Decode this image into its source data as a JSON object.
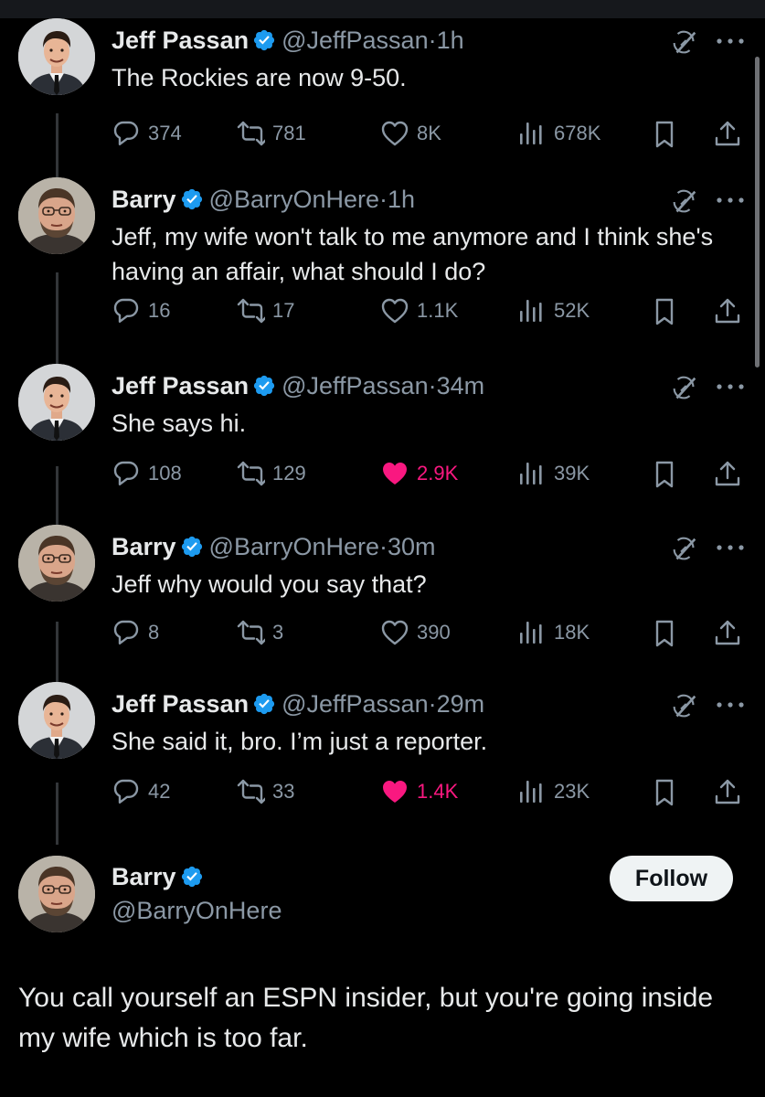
{
  "colors": {
    "background": "#000000",
    "text": "#e7e9ea",
    "muted": "#8b98a5",
    "verified": "#1d9bf0",
    "like": "#f91880"
  },
  "tweets": [
    {
      "name": "Jeff Passan",
      "handle": "@JeffPassan",
      "time": "1h",
      "text": "The Rockies are now 9-50.",
      "replies": "374",
      "retweets": "781",
      "likes": "8K",
      "liked": false,
      "views": "678K",
      "avatar": "jeff-avatar"
    },
    {
      "name": "Barry",
      "handle": "@BarryOnHere",
      "time": "1h",
      "text": "Jeff, my wife won't talk to me anymore and I think she's having an affair, what should I do?",
      "replies": "16",
      "retweets": "17",
      "likes": "1.1K",
      "liked": false,
      "views": "52K",
      "avatar": "barry-avatar"
    },
    {
      "name": "Jeff Passan",
      "handle": "@JeffPassan",
      "time": "34m",
      "text": "She says hi.",
      "replies": "108",
      "retweets": "129",
      "likes": "2.9K",
      "liked": true,
      "views": "39K",
      "avatar": "jeff-avatar"
    },
    {
      "name": "Barry",
      "handle": "@BarryOnHere",
      "time": "30m",
      "text": "Jeff why would you say that?",
      "replies": "8",
      "retweets": "3",
      "likes": "390",
      "liked": false,
      "views": "18K",
      "avatar": "barry-avatar"
    },
    {
      "name": "Jeff Passan",
      "handle": "@JeffPassan",
      "time": "29m",
      "text": "She said it, bro. I’m just a reporter.",
      "replies": "42",
      "retweets": "33",
      "likes": "1.4K",
      "liked": true,
      "views": "23K",
      "avatar": "jeff-avatar"
    }
  ],
  "main_tweet": {
    "name": "Barry",
    "handle": "@BarryOnHere",
    "follow_label": "Follow",
    "text": "You call yourself an ESPN insider, but you're going inside my wife which is too far."
  },
  "icons": {
    "verified": "verified-badge-icon",
    "grok": "grok-icon",
    "more": "more-icon",
    "reply": "reply-icon",
    "retweet": "retweet-icon",
    "like": "heart-icon",
    "views": "views-icon",
    "bookmark": "bookmark-icon",
    "share": "share-icon"
  }
}
